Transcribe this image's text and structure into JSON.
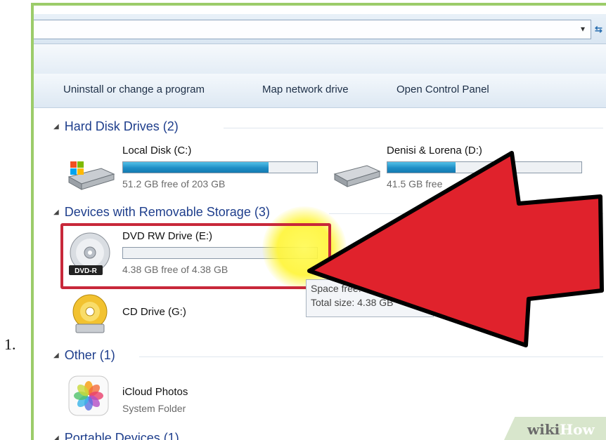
{
  "step": {
    "number": "1."
  },
  "toolbar": {
    "uninstall": "Uninstall or change a program",
    "map_drive": "Map network drive",
    "control_panel": "Open Control Panel"
  },
  "groups": {
    "hard_disks": {
      "title": "Hard Disk Drives (2)",
      "drives": [
        {
          "name": "Local Disk (C:)",
          "free": "51.2 GB free of 203 GB",
          "used_fraction": 0.75
        },
        {
          "name": "Denisi & Lorena (D:)",
          "free": "41.5 GB free",
          "used_fraction": 0.35
        }
      ]
    },
    "removable": {
      "title": "Devices with Removable Storage (3)",
      "dvd": {
        "name": "DVD RW Drive (E:)",
        "free": "4.38 GB free of 4.38 GB",
        "used_fraction": 0.0,
        "badge": "DVD-R"
      },
      "cd": {
        "name": "CD Drive (G:)"
      }
    },
    "other": {
      "title": "Other (1)",
      "item": {
        "name": "iCloud Photos",
        "type": "System Folder"
      }
    },
    "portable": {
      "title": "Portable Devices (1)"
    }
  },
  "tooltip": {
    "line1": "Space free: 4.38 GB",
    "line2": "Total size: 4.38 GB"
  },
  "watermark": {
    "prefix": "wiki",
    "suffix": "How"
  },
  "colors": {
    "arrow": "#e0222c",
    "highlight": "#c8283a",
    "bar_fill": "#1f8ec6"
  }
}
